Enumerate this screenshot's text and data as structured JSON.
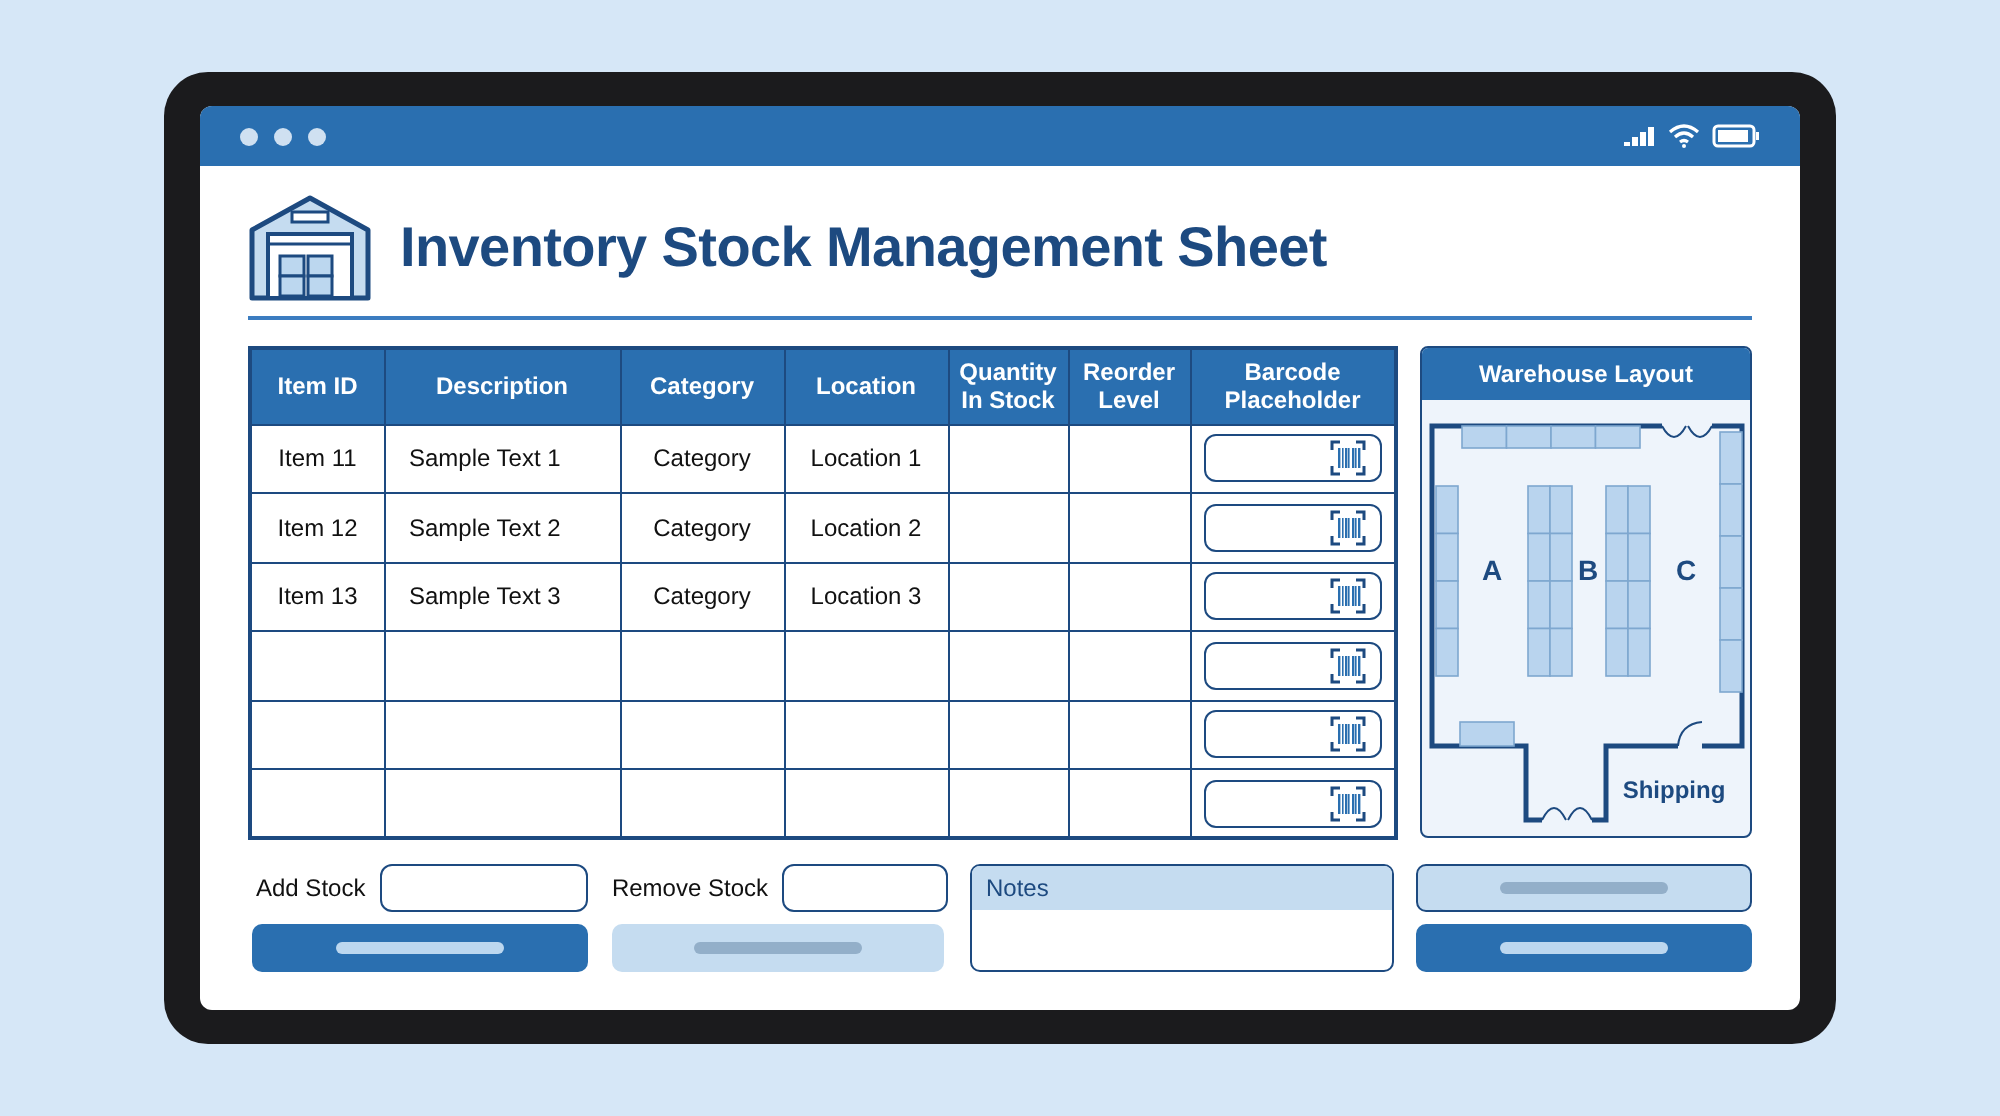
{
  "title": "Inventory Stock Management Sheet",
  "table": {
    "columns": [
      "Item ID",
      "Description",
      "Category",
      "Location",
      "Quantity In Stock",
      "Reorder Level",
      "Barcode Placeholder"
    ],
    "rows": [
      {
        "item_id": "Item 11",
        "description": "Sample Text 1",
        "category": "Category",
        "location": "Location 1"
      },
      {
        "item_id": "Item 12",
        "description": "Sample Text 2",
        "category": "Category",
        "location": "Location 2"
      },
      {
        "item_id": "Item 13",
        "description": "Sample Text 3",
        "category": "Category",
        "location": "Location 3"
      },
      {},
      {},
      {}
    ]
  },
  "warehouse_layout": {
    "title": "Warehouse Layout",
    "zones": [
      "A",
      "B",
      "C"
    ],
    "area_label": "Shipping"
  },
  "stock_fields": [
    {
      "label": "Add Stock"
    },
    {
      "label": "Remove Stock"
    }
  ],
  "stock_buttons": [
    {
      "kind": "primary"
    },
    {
      "kind": "secondary"
    }
  ],
  "notes": {
    "label": "Notes"
  },
  "layout_buttons": [
    {
      "kind": "secondary"
    },
    {
      "kind": "primary"
    }
  ]
}
